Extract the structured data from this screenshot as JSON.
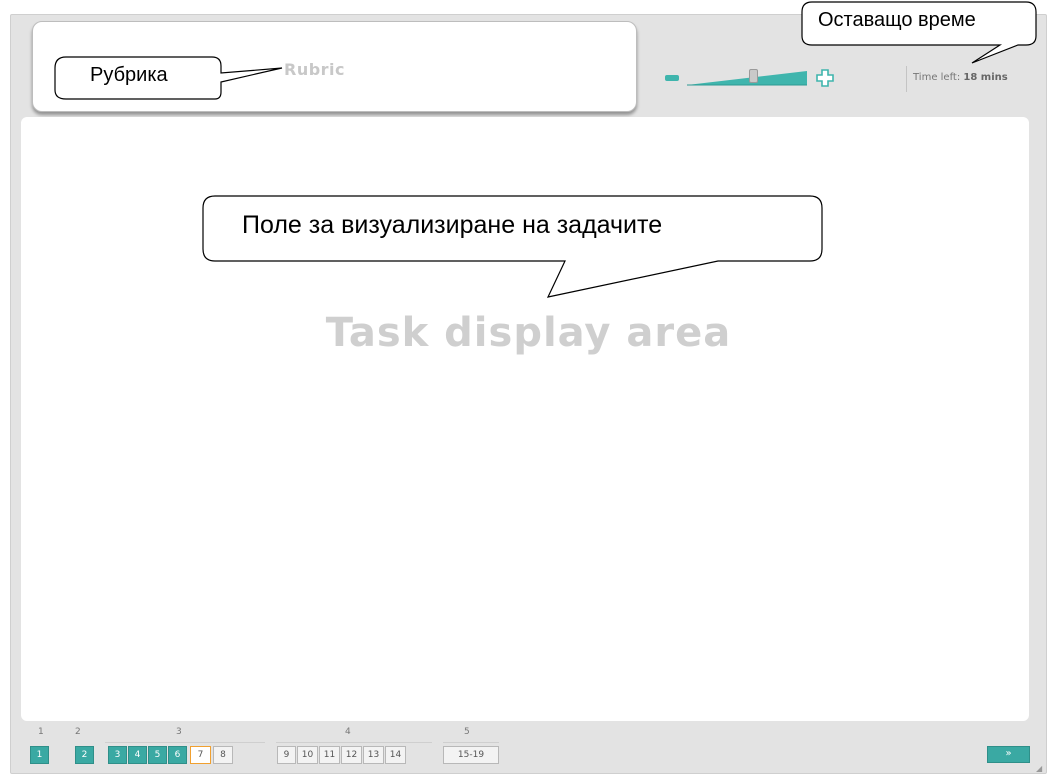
{
  "header": {
    "rubric_label": "Rubric",
    "zoom": {
      "level": 0.55,
      "minus_icon": "minus-icon",
      "plus_icon": "plus-icon"
    },
    "timer": {
      "prefix": "Time left:",
      "value": "18 mins"
    }
  },
  "main": {
    "task_area_label": "Task display area"
  },
  "annotations": {
    "rubric": "Рубрика",
    "time_left": "Оставащо време",
    "task_area": "Поле за визуализиране на задачите"
  },
  "navigation": {
    "sections": [
      {
        "label": "1"
      },
      {
        "label": "2"
      },
      {
        "label": "3"
      },
      {
        "label": "4"
      },
      {
        "label": "5"
      }
    ],
    "questions": [
      {
        "label": "1",
        "state": "done"
      },
      {
        "label": "2",
        "state": "done"
      },
      {
        "label": "3",
        "state": "done"
      },
      {
        "label": "4",
        "state": "done"
      },
      {
        "label": "5",
        "state": "done"
      },
      {
        "label": "6",
        "state": "done"
      },
      {
        "label": "7",
        "state": "current"
      },
      {
        "label": "8",
        "state": "todo"
      },
      {
        "label": "9",
        "state": "todo"
      },
      {
        "label": "10",
        "state": "todo"
      },
      {
        "label": "11",
        "state": "todo"
      },
      {
        "label": "12",
        "state": "todo"
      },
      {
        "label": "13",
        "state": "todo"
      },
      {
        "label": "14",
        "state": "todo"
      },
      {
        "label": "15-19",
        "state": "todo"
      }
    ],
    "next_label": "»",
    "next_icon": "double-chevron-right-icon"
  },
  "colors": {
    "accent": "#3aa9a3",
    "current_border": "#f0a030",
    "watermark_text": "#cfcfcf"
  }
}
